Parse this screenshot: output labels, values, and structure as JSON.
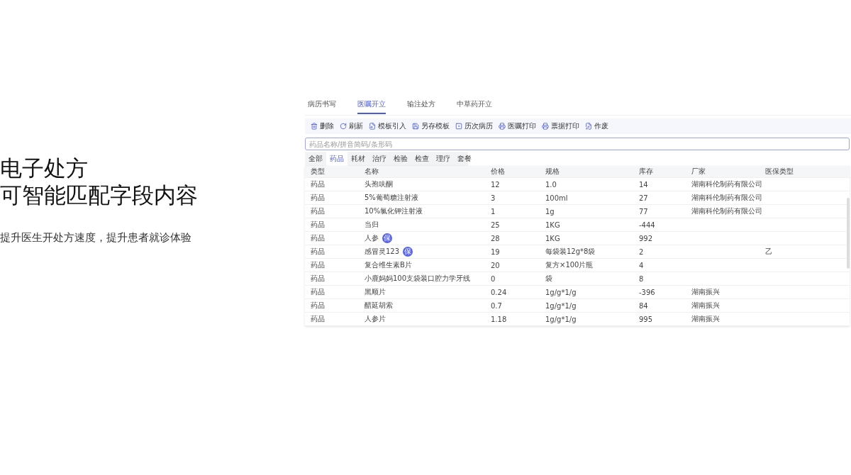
{
  "intro": {
    "title_lines": [
      "电子处方",
      "可智能匹配字段内容"
    ],
    "subtitle": "提升医生开处方速度，提升患者就诊体验"
  },
  "tabs": [
    {
      "label": "病历书写",
      "selected": false
    },
    {
      "label": "医嘱开立",
      "selected": true
    },
    {
      "label": "输注处方",
      "selected": false
    },
    {
      "label": "中草药开立",
      "selected": false
    }
  ],
  "toolbar": [
    {
      "kind": "delete",
      "label": "删除"
    },
    {
      "kind": "refresh",
      "label": "刷新"
    },
    {
      "kind": "import",
      "label": "模板引入"
    },
    {
      "kind": "save",
      "label": "另存模板"
    },
    {
      "kind": "history",
      "label": "历次病历"
    },
    {
      "kind": "print",
      "label": "医嘱打印"
    },
    {
      "kind": "print",
      "label": "票据打印"
    },
    {
      "kind": "void",
      "label": "作废"
    }
  ],
  "search": {
    "placeholder": "药品名称/拼音简码/条形码"
  },
  "categories": [
    {
      "label": "全部",
      "selected": false
    },
    {
      "label": "药品",
      "selected": true
    },
    {
      "label": "耗材",
      "selected": false
    },
    {
      "label": "治疗",
      "selected": false
    },
    {
      "label": "检验",
      "selected": false
    },
    {
      "label": "检查",
      "selected": false
    },
    {
      "label": "理疗",
      "selected": false
    },
    {
      "label": "套餐",
      "selected": false
    }
  ],
  "table": {
    "columns": [
      "类型",
      "名称",
      "价格",
      "规格",
      "库存",
      "厂家",
      "医保类型"
    ],
    "rows": [
      {
        "type": "药品",
        "name": "头孢呋酮",
        "price": "12",
        "spec": "1.0",
        "stock": "14",
        "vendor": "湖南科伦制药有限公司"
      },
      {
        "type": "药品",
        "name": "5%葡萄糖注射液",
        "price": "3",
        "spec": "100ml",
        "stock": "27",
        "vendor": "湖南科伦制药有限公司"
      },
      {
        "type": "药品",
        "name": "10%氯化钾注射液",
        "price": "1",
        "spec": "1g",
        "stock": "77",
        "vendor": "湖南科伦制药有限公司"
      },
      {
        "type": "药品",
        "name": "当归",
        "price": "25",
        "spec": "1KG",
        "stock": "-444"
      },
      {
        "type": "药品",
        "name": "人参",
        "badge": "保",
        "price": "28",
        "spec": "1KG",
        "stock": "992"
      },
      {
        "type": "药品",
        "name": "感冒灵123",
        "badge": "保",
        "price": "19",
        "spec": "每袋装12g*8袋",
        "stock": "2",
        "insurance": "乙"
      },
      {
        "type": "药品",
        "name": "复合维生素B片",
        "price": "20",
        "spec": "复方×100片瓶",
        "stock": "4"
      },
      {
        "type": "药品",
        "name": "小鹿妈妈100支袋装口腔力学牙线",
        "price": "0",
        "spec": "袋",
        "stock": "8"
      },
      {
        "type": "药品",
        "name": "黑顺片",
        "price": "0.24",
        "spec": "1g/g*1/g",
        "stock": "-396",
        "vendor": "湖南振兴"
      },
      {
        "type": "药品",
        "name": "醋延胡索",
        "price": "0.7",
        "spec": "1g/g*1/g",
        "stock": "84",
        "vendor": "湖南振兴"
      },
      {
        "type": "药品",
        "name": "人参片",
        "price": "1.18",
        "spec": "1g/g*1/g",
        "stock": "995",
        "vendor": "湖南振兴"
      }
    ]
  }
}
